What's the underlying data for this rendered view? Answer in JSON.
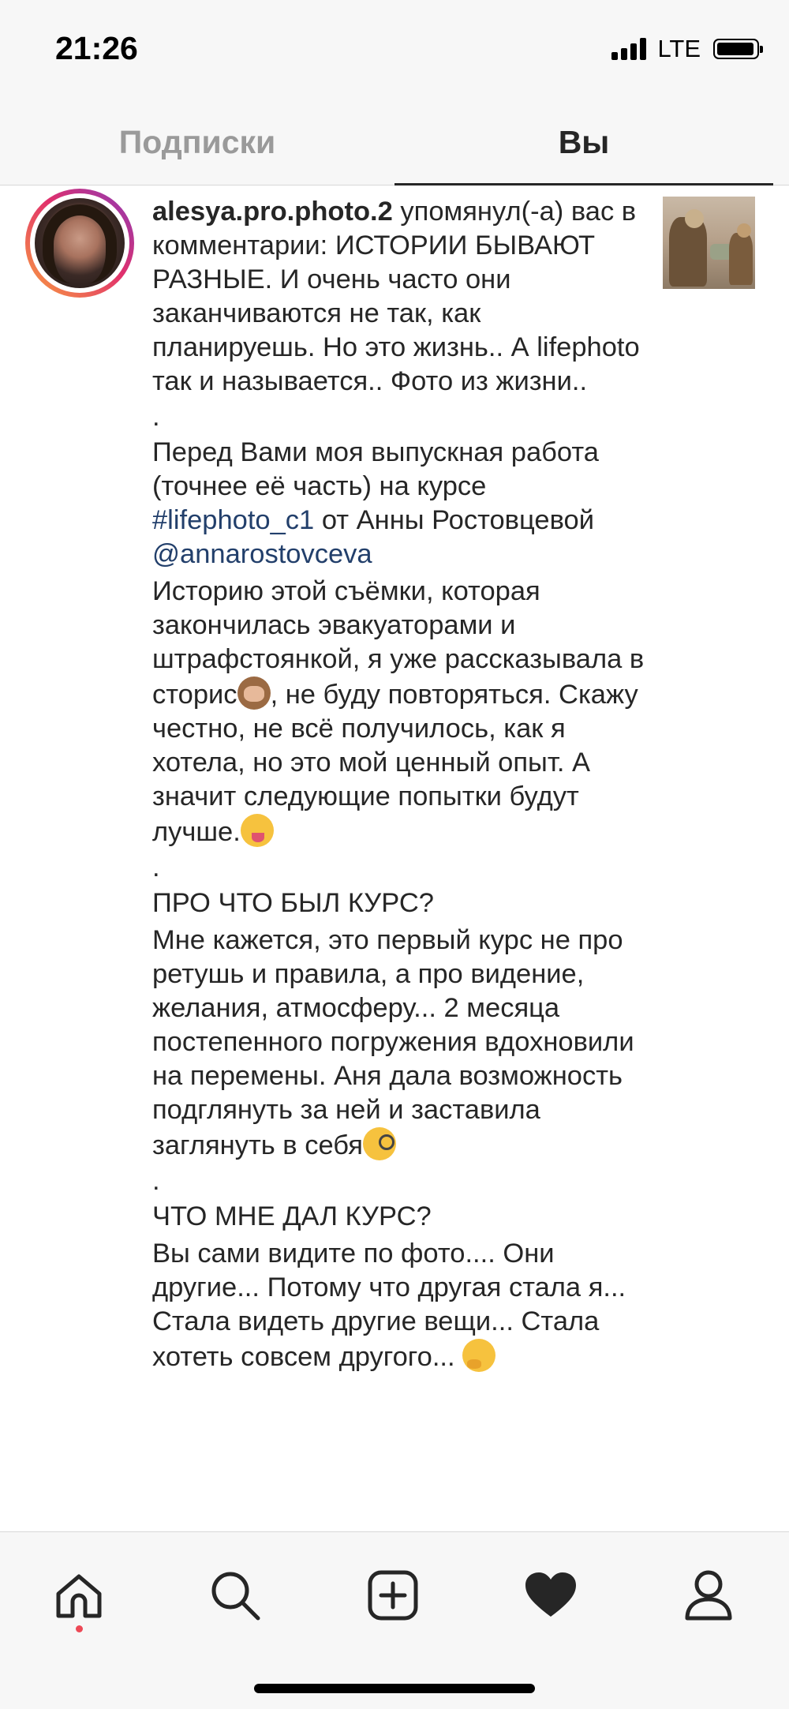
{
  "status_bar": {
    "time": "21:26",
    "network": "LTE"
  },
  "tabs": {
    "following": "Подписки",
    "you": "Вы",
    "active": "you"
  },
  "notification": {
    "username": "alesya.pro.photo.2",
    "action": " упомянул(-а) вас в комментарии: ",
    "p1": "ИСТОРИИ БЫВАЮТ РАЗНЫЕ. И очень часто они заканчиваются не так, как планируешь. Но это жизнь.. А lifephoto так и называется.. Фото из жизни..",
    "dot1": ".",
    "p2_a": "Перед Вами моя выпускная работа (точнее её часть) на курсе ",
    "hashtag": "#lifephoto_c1",
    "p2_b": " от Анны Ростовцевой ",
    "mention": "@annarostovceva",
    "p3_a": "Историю этой съёмки, которая закончилась эвакуаторами и штрафстоянкой, я уже рассказывала в сторис",
    "p3_b": ", не буду повторяться. Скажу честно, не всё получилось, как я хотела, но это мой ценный опыт. А значит следующие попытки будут лучше.",
    "dot2": ".",
    "h1": "ПРО ЧТО БЫЛ КУРС?",
    "p4": "Мне кажется, это первый курс не про ретушь и правила, а про видение, желания, атмосферу... 2 месяца постепенного погружения вдохновили на перемены. Аня дала возможность подглянуть за ней и заставила заглянуть в себя",
    "dot3": ".",
    "h2": "ЧТО МНЕ ДАЛ КУРС?",
    "p5": "Вы сами видите по фото.... Они другие... Потому что  другая стала я... Стала видеть другие вещи... Стала хотеть совсем другого... ",
    "emojis": [
      "see-no-evil-monkey",
      "winking-tongue-face",
      "monocle-face",
      "thinking-face"
    ]
  },
  "bottom_nav": {
    "items": [
      "home-icon",
      "search-icon",
      "new-post-icon",
      "activity-heart-icon",
      "profile-icon"
    ],
    "active": "activity-heart-icon"
  },
  "colors": {
    "link": "#223f6b",
    "text": "#262626",
    "tab_inactive": "#9a9a9a",
    "badge": "#ed4956"
  }
}
